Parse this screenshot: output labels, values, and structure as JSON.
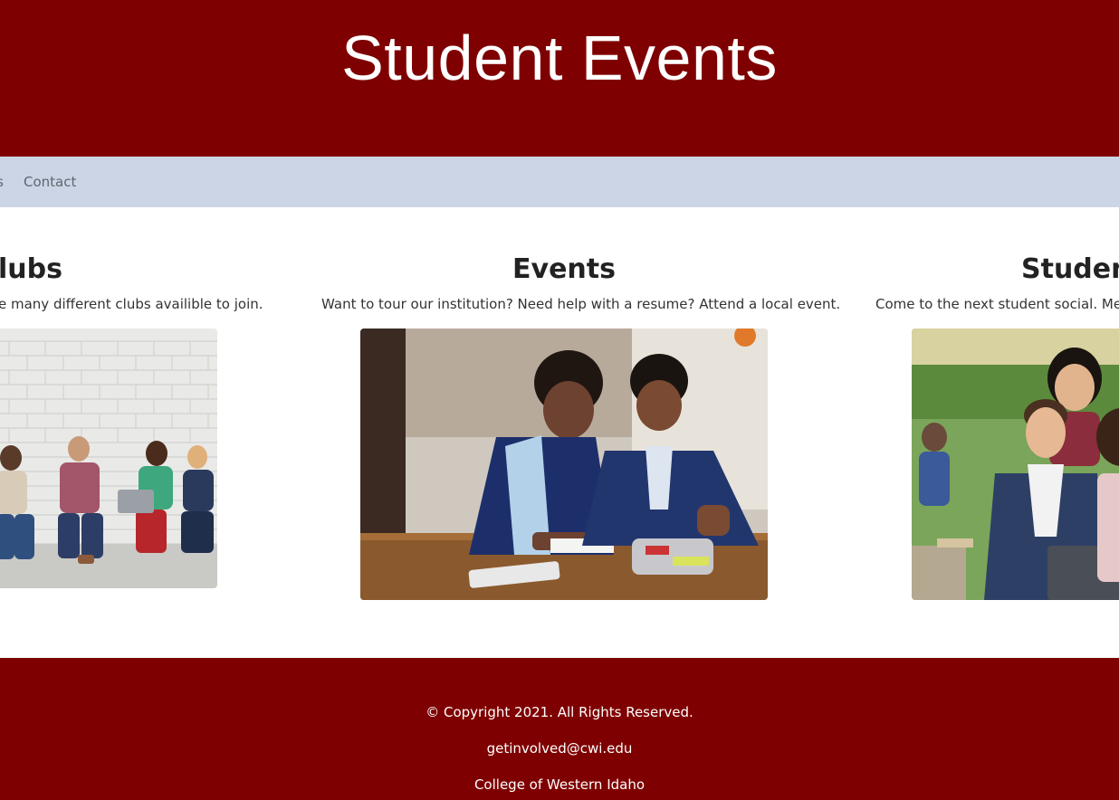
{
  "header": {
    "title": "Student Events"
  },
  "nav": {
    "partial_item": "rs",
    "contact_label": "Contact"
  },
  "cards": [
    {
      "title": "lubs",
      "text": "e many different clubs availible to join.",
      "image": "students-sitting-against-brick-wall"
    },
    {
      "title": "Events",
      "text": "Want to tour our institution? Need help with a resume? Attend a local event.",
      "image": "students-studying-at-desk"
    },
    {
      "title": "Student",
      "text": "Come to the next student social. Meet",
      "image": "smiling-students-outdoors-with-laptop"
    }
  ],
  "footer": {
    "copyright": "© Copyright 2021. All Rights Reserved.",
    "email": "getinvolved@cwi.edu",
    "college": "College of Western Idaho"
  },
  "colors": {
    "brand_maroon": "#7f0000",
    "nav_background": "#cbd5e6",
    "heading_text": "#222222"
  }
}
